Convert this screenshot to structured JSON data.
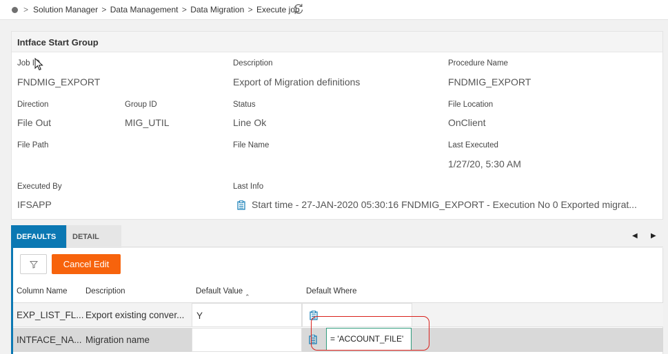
{
  "breadcrumb": {
    "items": [
      "Solution Manager",
      "Data Management",
      "Data Migration",
      "Execute job"
    ],
    "separator": ">"
  },
  "header": {
    "title": "Intface Start Group",
    "fields": {
      "job_id": {
        "label": "Job ID",
        "value": "FNDMIG_EXPORT"
      },
      "description": {
        "label": "Description",
        "value": "Export of Migration definitions"
      },
      "procedure_name": {
        "label": "Procedure Name",
        "value": "FNDMIG_EXPORT"
      },
      "direction": {
        "label": "Direction",
        "value": "File Out"
      },
      "group_id": {
        "label": "Group ID",
        "value": "MIG_UTIL"
      },
      "status": {
        "label": "Status",
        "value": "Line Ok"
      },
      "file_location": {
        "label": "File Location",
        "value": "OnClient"
      },
      "file_path": {
        "label": "File Path",
        "value": ""
      },
      "file_name": {
        "label": "File Name",
        "value": ""
      },
      "last_executed": {
        "label": "Last Executed",
        "value": "1/27/20, 5:30 AM"
      },
      "executed_by": {
        "label": "Executed By",
        "value": "IFSAPP"
      },
      "last_info": {
        "label": "Last Info",
        "value": "Start time - 27-JAN-2020 05:30:16   FNDMIG_EXPORT - Execution No 0 Exported migrat..."
      }
    }
  },
  "tabs": [
    {
      "label": "DEFAULTS",
      "active": true
    },
    {
      "label": "DETAIL",
      "active": false
    }
  ],
  "toolbar": {
    "cancel_label": "Cancel Edit"
  },
  "grid": {
    "columns": [
      "Column Name",
      "Description",
      "Default Value",
      "Default Where"
    ],
    "rows": [
      {
        "column_name": "EXP_LIST_FL...",
        "description": "Export existing conver...",
        "default_value": "Y",
        "default_where": ""
      },
      {
        "column_name": "INTFACE_NA...",
        "description": "Migration name",
        "default_value": "",
        "default_where": "= 'ACCOUNT_FILE'"
      }
    ]
  },
  "colors": {
    "accent": "#0b78b3",
    "cancel_button": "#f7630c",
    "highlight": "#d9201b",
    "edit_focus": "#2e9b7c"
  },
  "icons": [
    "circle-icon",
    "chevron-right-icon",
    "refresh-icon",
    "clipboard-icon",
    "filter-icon",
    "arrow-left-icon",
    "arrow-right-icon",
    "mouse-cursor-icon"
  ]
}
